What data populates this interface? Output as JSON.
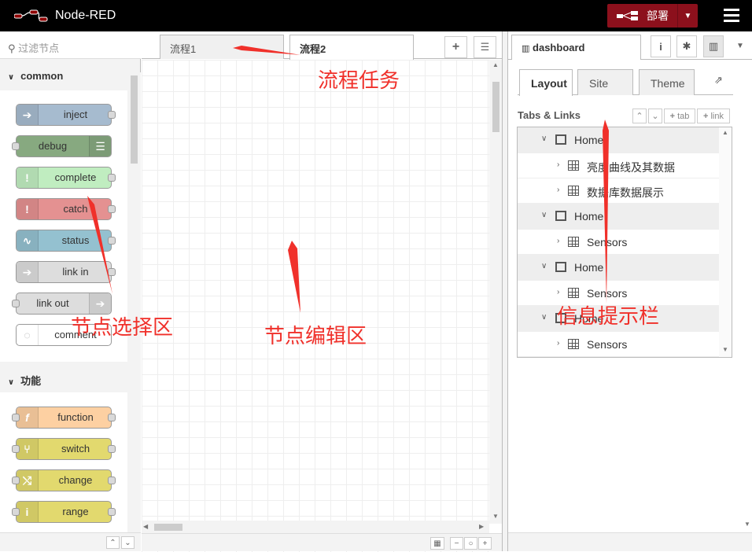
{
  "header": {
    "app_title": "Node-RED",
    "deploy_label": "部署"
  },
  "palette": {
    "search_placeholder": "过滤节点",
    "categories": [
      {
        "label": "common",
        "nodes": [
          "inject",
          "debug",
          "complete",
          "catch",
          "status",
          "link in",
          "link out",
          "comment"
        ]
      },
      {
        "label": "功能",
        "nodes": [
          "function",
          "switch",
          "change",
          "range"
        ]
      }
    ]
  },
  "workspace": {
    "tabs": [
      "流程1",
      "流程2"
    ]
  },
  "sidebar": {
    "tab_label": "dashboard",
    "sub_tabs": [
      "Layout",
      "Site",
      "Theme"
    ],
    "section_title": "Tabs & Links",
    "tab_btn": "tab",
    "link_btn": "link",
    "tree": [
      {
        "type": "group",
        "label": "Home"
      },
      {
        "type": "item",
        "label": "亮度曲线及其数据"
      },
      {
        "type": "item",
        "label": "数据库数据展示"
      },
      {
        "type": "group",
        "label": "Home"
      },
      {
        "type": "item",
        "label": "Sensors"
      },
      {
        "type": "group",
        "label": "Home"
      },
      {
        "type": "item",
        "label": "Sensors"
      },
      {
        "type": "group",
        "label": "Home"
      },
      {
        "type": "item",
        "label": "Sensors"
      }
    ]
  },
  "annotations": {
    "flow_tasks": "流程任务",
    "node_select": "节点选择区",
    "node_edit": "节点编辑区",
    "info_bar": "信息提示栏"
  },
  "colors": {
    "header_bg": "#000000",
    "deploy_bg": "#8c101c",
    "annotation": "#f0302a",
    "inject": "#a6bbcf",
    "debug": "#87a980",
    "complete": "#c0edc0",
    "catch": "#e49191",
    "status": "#94c1d0",
    "link": "#dddddd",
    "function": "#fdd0a2",
    "switch": "#e2d96e"
  }
}
